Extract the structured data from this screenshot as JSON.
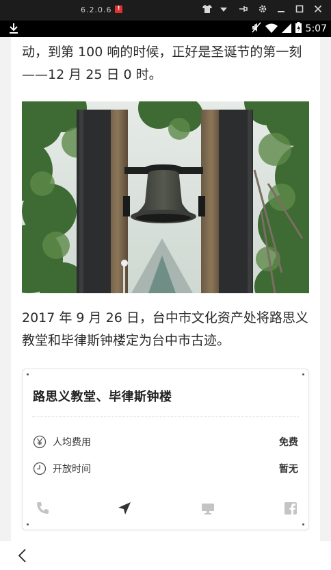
{
  "emulator": {
    "version": "6.2.0.6",
    "alert": "!",
    "controls": [
      "shirt-icon",
      "chevron-down-icon",
      "pin-icon",
      "gear-icon",
      "minimize-icon",
      "maximize-icon",
      "close-icon"
    ]
  },
  "status_bar": {
    "time": "5:07",
    "icons": [
      "download-icon",
      "mute-icon",
      "wifi-icon",
      "signal-icon",
      "battery-icon"
    ]
  },
  "article": {
    "para1": "动，到第 100 响的时候，正好是圣诞节的第一刻——12 月 25 日 0 时。",
    "photo_alt": "钟楼与铜钟",
    "para2": "2017 年 9 月 26 日，台中市文化资产处将路思义教堂和毕律斯钟楼定为台中市古迹。"
  },
  "card": {
    "title": "路思义教堂、毕律斯钟楼",
    "rows": [
      {
        "icon": "yen-icon",
        "label": "人均费用",
        "value": "免费"
      },
      {
        "icon": "clock-icon",
        "label": "开放时间",
        "value": "暂无"
      }
    ],
    "actions": [
      "phone-icon",
      "navigate-icon",
      "computer-icon",
      "facebook-icon"
    ]
  },
  "nav": {
    "back": "back-icon"
  },
  "colors": {
    "text": "#2a2a2a",
    "card_border": "#e3e3e3",
    "action_icon": "#c4c4c4",
    "navigate_icon": "#333333"
  }
}
